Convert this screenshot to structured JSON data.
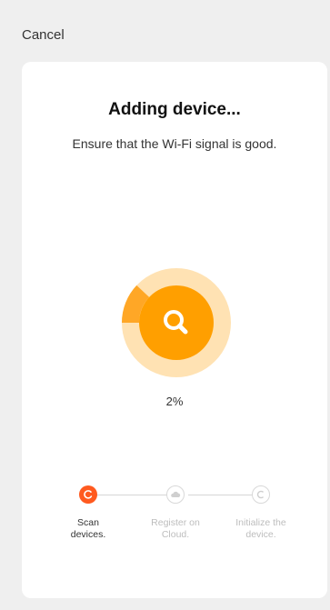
{
  "header": {
    "cancel_label": "Cancel"
  },
  "main": {
    "title": "Adding device...",
    "subtitle": "Ensure that the Wi-Fi signal is good.",
    "progress_fraction": 0.02,
    "progress_label": "2%",
    "icon": "search-icon"
  },
  "steps": [
    {
      "line1": "Scan",
      "line2": "devices.",
      "state": "active",
      "icon": "refresh-icon"
    },
    {
      "line1": "Register on",
      "line2": "Cloud.",
      "state": "inactive",
      "icon": "cloud-icon"
    },
    {
      "line1": "Initialize the",
      "line2": "device.",
      "state": "inactive",
      "icon": "initialize-icon"
    }
  ],
  "colors": {
    "accent": "#ff9f00",
    "accent_light": "#ffe2b3",
    "active_step": "#ff5a1f"
  }
}
